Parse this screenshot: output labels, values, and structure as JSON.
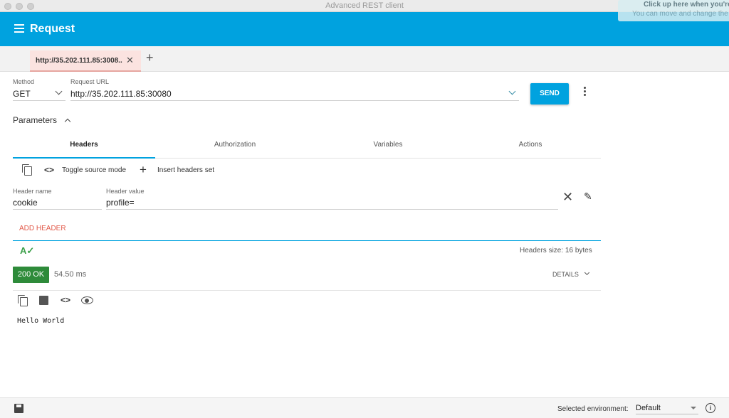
{
  "window": {
    "title": "Advanced REST client"
  },
  "toast": {
    "line1": "Click up here when you're",
    "line2": "You can move and change the"
  },
  "appbar": {
    "title": "Request"
  },
  "tabs": [
    {
      "label": "http://35.202.111.85:3008.."
    }
  ],
  "request": {
    "method_label": "Method",
    "method": "GET",
    "url_label": "Request URL",
    "url": "http://35.202.111.85:30080",
    "send_label": "SEND"
  },
  "parameters": {
    "label": "Parameters",
    "tabs": [
      "Headers",
      "Authorization",
      "Variables",
      "Actions"
    ],
    "active_tab": "Headers",
    "toolbar": {
      "toggle_label": "Toggle source mode",
      "insert_label": "Insert headers set"
    },
    "header_row": {
      "name_label": "Header name",
      "name": "cookie",
      "value_label": "Header value",
      "value": "profile="
    },
    "add_header_label": "ADD HEADER",
    "headers_size": "Headers size: 16 bytes"
  },
  "response": {
    "status": "200 OK",
    "time": "54.50 ms",
    "details_label": "DETAILS",
    "body": "Hello World"
  },
  "footer": {
    "env_label": "Selected environment:",
    "env_value": "Default"
  },
  "colors": {
    "accent": "#00a2df",
    "status_ok": "#2e8b3a",
    "add_header": "#e25a4a"
  }
}
